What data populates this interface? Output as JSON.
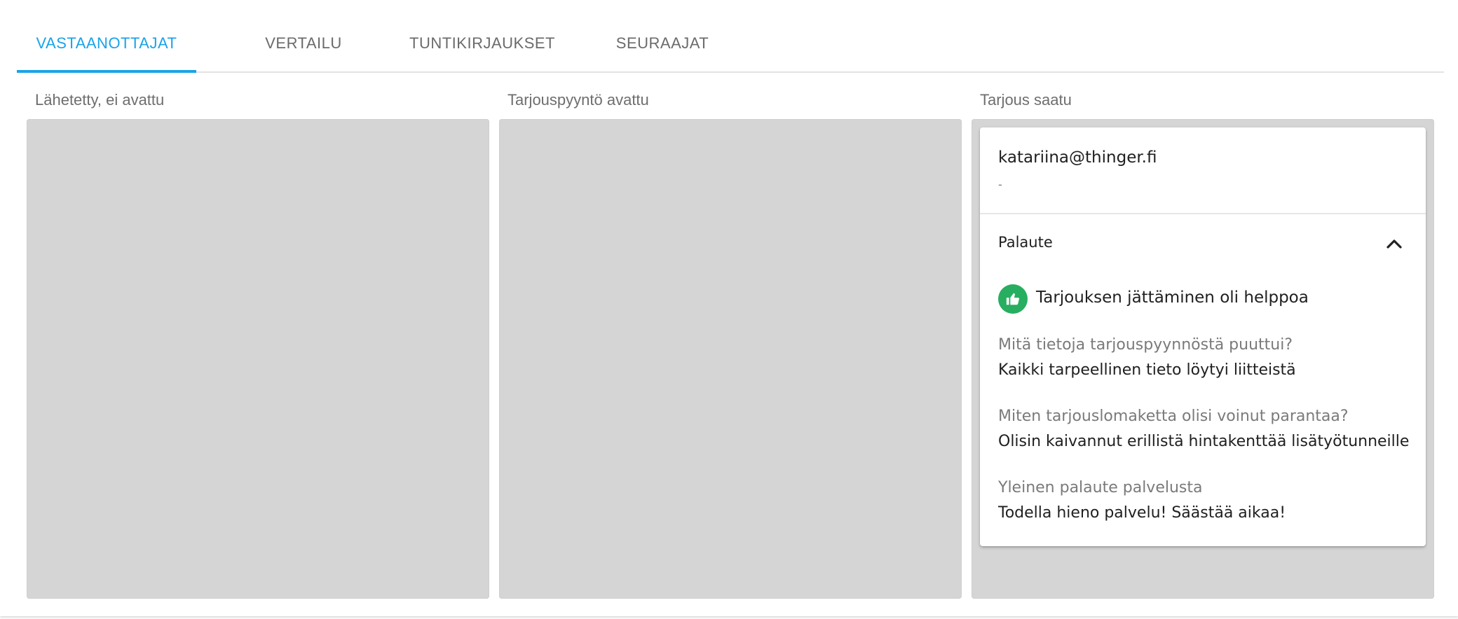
{
  "tabs": [
    {
      "label": "VASTAANOTTAJAT",
      "active": true
    },
    {
      "label": "VERTAILU",
      "active": false
    },
    {
      "label": "TUNTIKIRJAUKSET",
      "active": false
    },
    {
      "label": "SEURAAJAT",
      "active": false
    }
  ],
  "columns": [
    {
      "label": "Lähetetty, ei avattu"
    },
    {
      "label": "Tarjouspyyntö avattu"
    },
    {
      "label": "Tarjous saatu"
    }
  ],
  "card": {
    "email": "katariina@thinger.fi",
    "subtitle": "-",
    "feedback_title": "Palaute",
    "rating_text": "Tarjouksen jättäminen oli helppoa",
    "qa": [
      {
        "question": "Mitä tietoja tarjouspyynnöstä puuttui?",
        "answer": "Kaikki tarpeellinen tieto löytyi liitteistä"
      },
      {
        "question": "Miten tarjouslomaketta olisi voinut parantaa?",
        "answer": "Olisin kaivannut erillistä hintakenttää lisätyötunneille"
      },
      {
        "question": "Yleinen palaute palvelusta",
        "answer": "Todella hieno palvelu! Säästää aikaa!"
      }
    ]
  },
  "colors": {
    "accent": "#1aa3e8",
    "positive": "#27ae60",
    "column_bg": "#d5d5d5"
  },
  "icons": {
    "rating": "thumbs-up-icon",
    "collapse": "chevron-up-icon"
  }
}
